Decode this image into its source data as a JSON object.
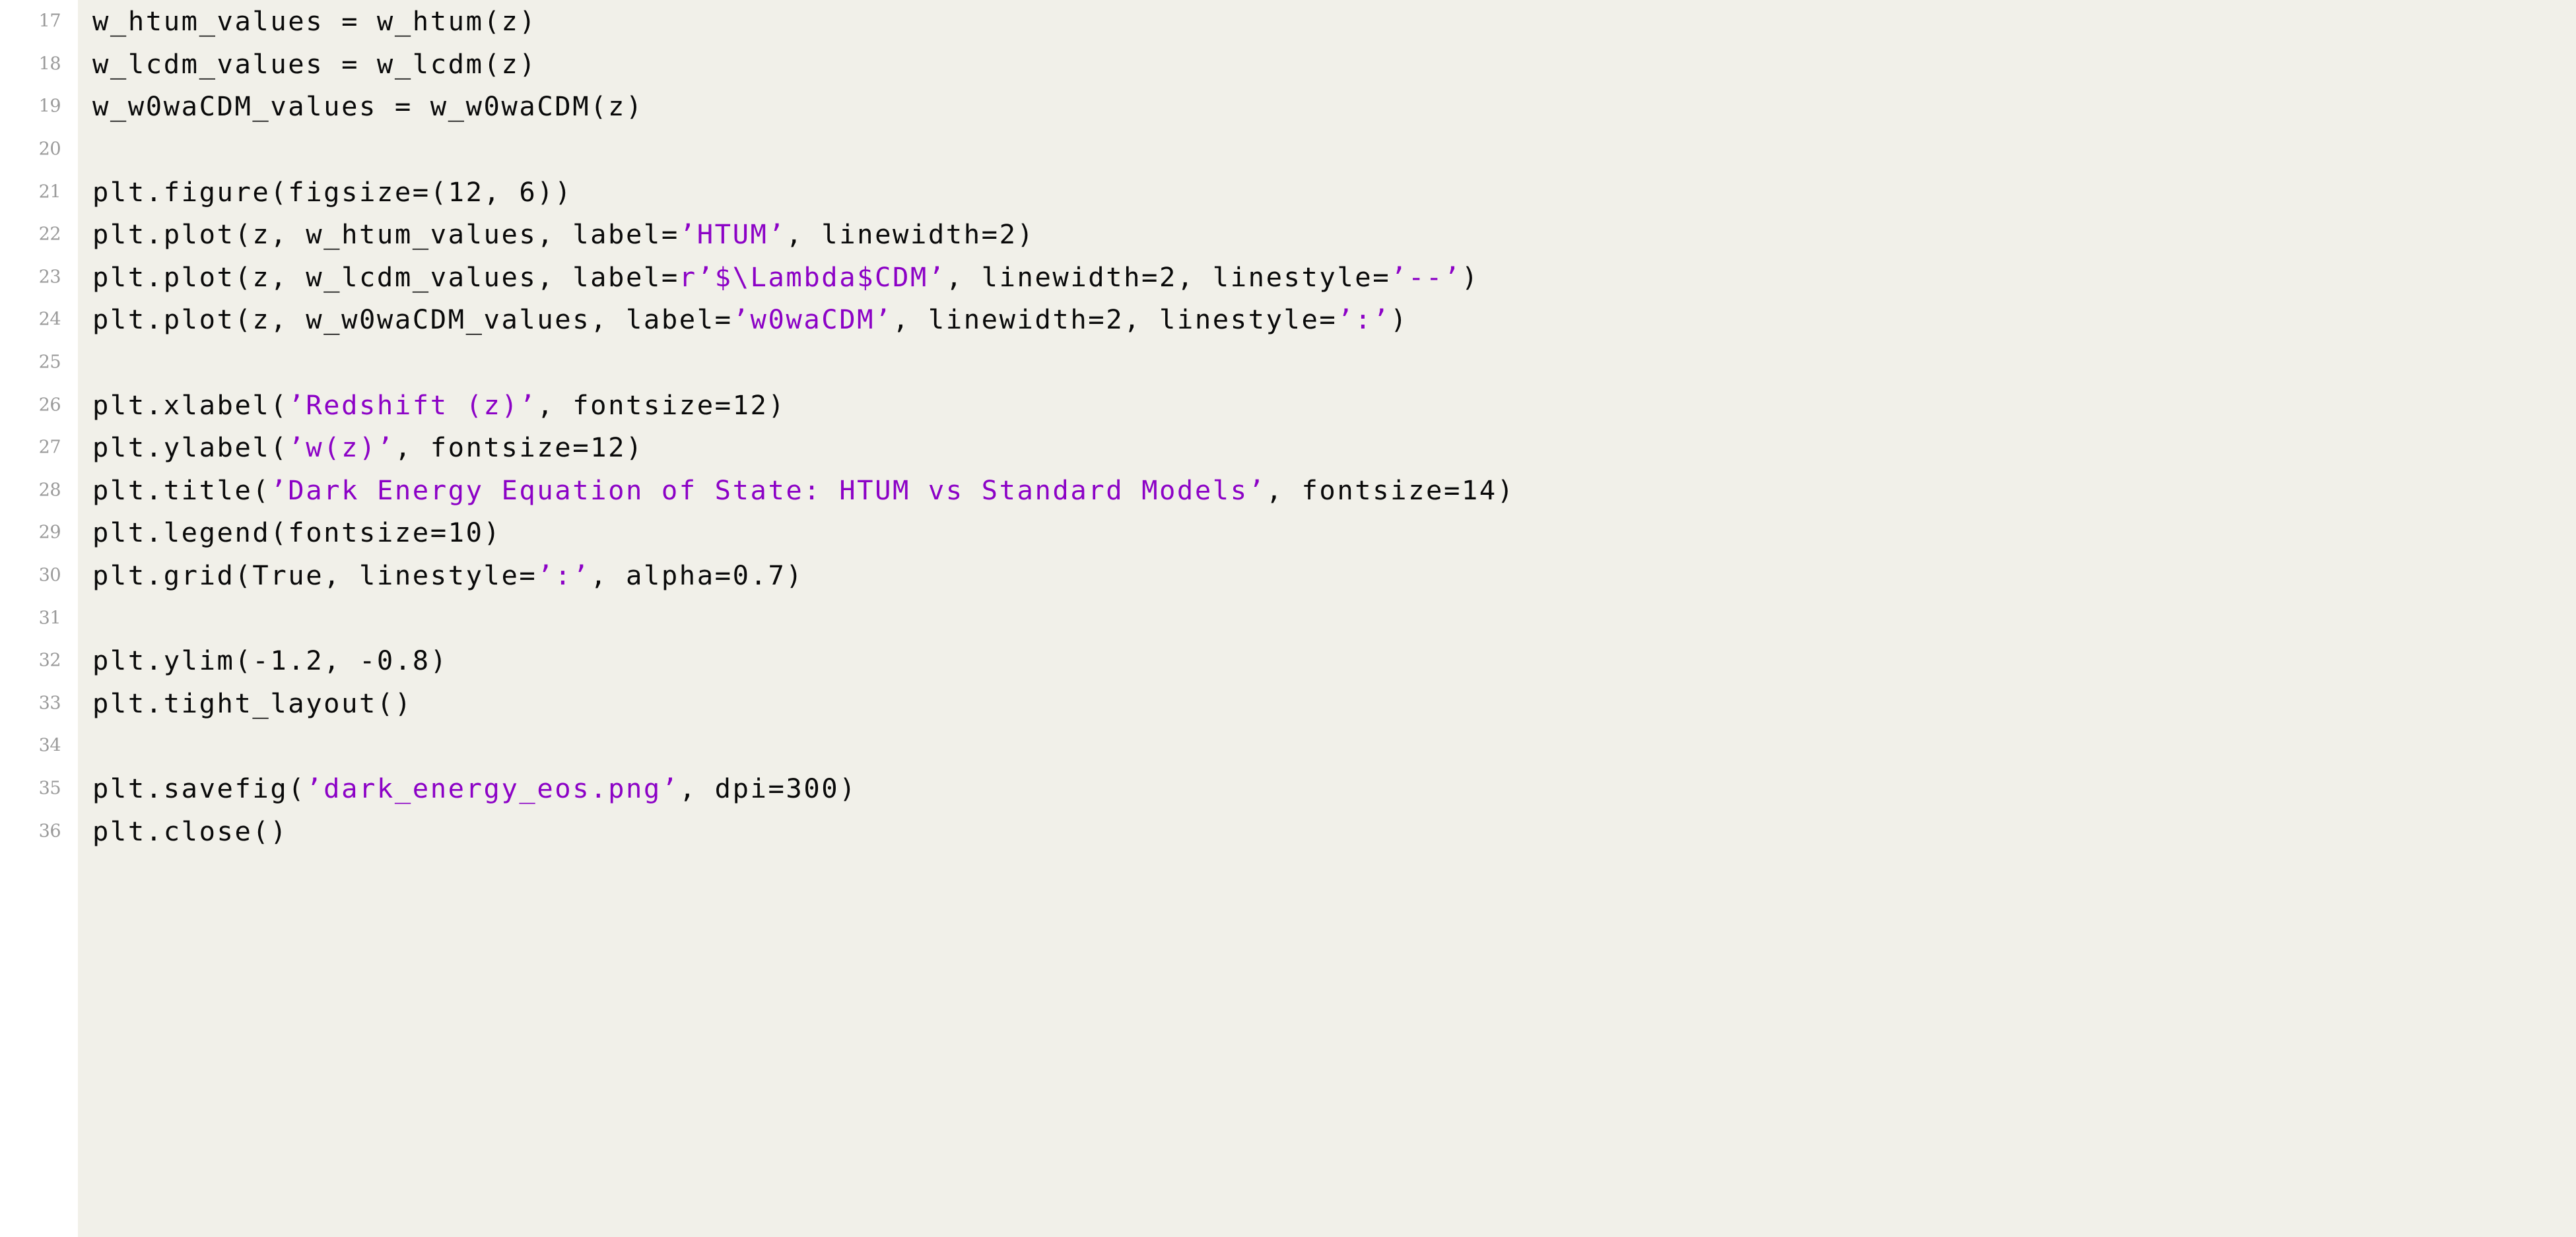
{
  "document": {
    "kind": "code-listing",
    "language": "python",
    "background_color": "#f1f0e9",
    "gutter_color": "#ffffff",
    "code_color": "#0a0a0a",
    "string_color": "#8c02c6",
    "line_number_color": "#9a9a9a",
    "first_line_number": 17,
    "last_line_number": 36
  },
  "lines": [
    {
      "number": "17",
      "tokens": [
        {
          "t": "w_htum_values = w_htum(z)",
          "c": "plain"
        }
      ]
    },
    {
      "number": "18",
      "tokens": [
        {
          "t": "w_lcdm_values = w_lcdm(z)",
          "c": "plain"
        }
      ]
    },
    {
      "number": "19",
      "tokens": [
        {
          "t": "w_w0waCDM_values = w_w0waCDM(z)",
          "c": "plain"
        }
      ]
    },
    {
      "number": "20",
      "tokens": []
    },
    {
      "number": "21",
      "tokens": [
        {
          "t": "plt.figure(figsize=(12, 6))",
          "c": "plain"
        }
      ]
    },
    {
      "number": "22",
      "tokens": [
        {
          "t": "plt.plot(z, w_htum_values, label=",
          "c": "plain"
        },
        {
          "t": "’HTUM’",
          "c": "str"
        },
        {
          "t": ", linewidth=2)",
          "c": "plain"
        }
      ]
    },
    {
      "number": "23",
      "tokens": [
        {
          "t": "plt.plot(z, w_lcdm_values, label=",
          "c": "plain"
        },
        {
          "t": "r’$\\Lambda$CDM’",
          "c": "str"
        },
        {
          "t": ", linewidth=2, linestyle=",
          "c": "plain"
        },
        {
          "t": "’--’",
          "c": "str"
        },
        {
          "t": ")",
          "c": "plain"
        }
      ]
    },
    {
      "number": "24",
      "tokens": [
        {
          "t": "plt.plot(z, w_w0waCDM_values, label=",
          "c": "plain"
        },
        {
          "t": "’w0waCDM’",
          "c": "str"
        },
        {
          "t": ", linewidth=2, linestyle=",
          "c": "plain"
        },
        {
          "t": "’:’",
          "c": "str"
        },
        {
          "t": ")",
          "c": "plain"
        }
      ]
    },
    {
      "number": "25",
      "tokens": []
    },
    {
      "number": "26",
      "tokens": [
        {
          "t": "plt.xlabel(",
          "c": "plain"
        },
        {
          "t": "’Redshift (z)’",
          "c": "str"
        },
        {
          "t": ", fontsize=12)",
          "c": "plain"
        }
      ]
    },
    {
      "number": "27",
      "tokens": [
        {
          "t": "plt.ylabel(",
          "c": "plain"
        },
        {
          "t": "’w(z)’",
          "c": "str"
        },
        {
          "t": ", fontsize=12)",
          "c": "plain"
        }
      ]
    },
    {
      "number": "28",
      "tokens": [
        {
          "t": "plt.title(",
          "c": "plain"
        },
        {
          "t": "’Dark Energy Equation of State: HTUM vs Standard Models’",
          "c": "str"
        },
        {
          "t": ", fontsize=14)",
          "c": "plain"
        }
      ]
    },
    {
      "number": "29",
      "tokens": [
        {
          "t": "plt.legend(fontsize=10)",
          "c": "plain"
        }
      ]
    },
    {
      "number": "30",
      "tokens": [
        {
          "t": "plt.grid(True, linestyle=",
          "c": "plain"
        },
        {
          "t": "’:’",
          "c": "str"
        },
        {
          "t": ", alpha=0.7)",
          "c": "plain"
        }
      ]
    },
    {
      "number": "31",
      "tokens": []
    },
    {
      "number": "32",
      "tokens": [
        {
          "t": "plt.ylim(-1.2, -0.8)",
          "c": "plain"
        }
      ]
    },
    {
      "number": "33",
      "tokens": [
        {
          "t": "plt.tight_layout()",
          "c": "plain"
        }
      ]
    },
    {
      "number": "34",
      "tokens": []
    },
    {
      "number": "35",
      "tokens": [
        {
          "t": "plt.savefig(",
          "c": "plain"
        },
        {
          "t": "’dark_energy_eos.png’",
          "c": "str"
        },
        {
          "t": ", dpi=300)",
          "c": "plain"
        }
      ]
    },
    {
      "number": "36",
      "tokens": [
        {
          "t": "plt.close()",
          "c": "plain"
        }
      ]
    }
  ]
}
